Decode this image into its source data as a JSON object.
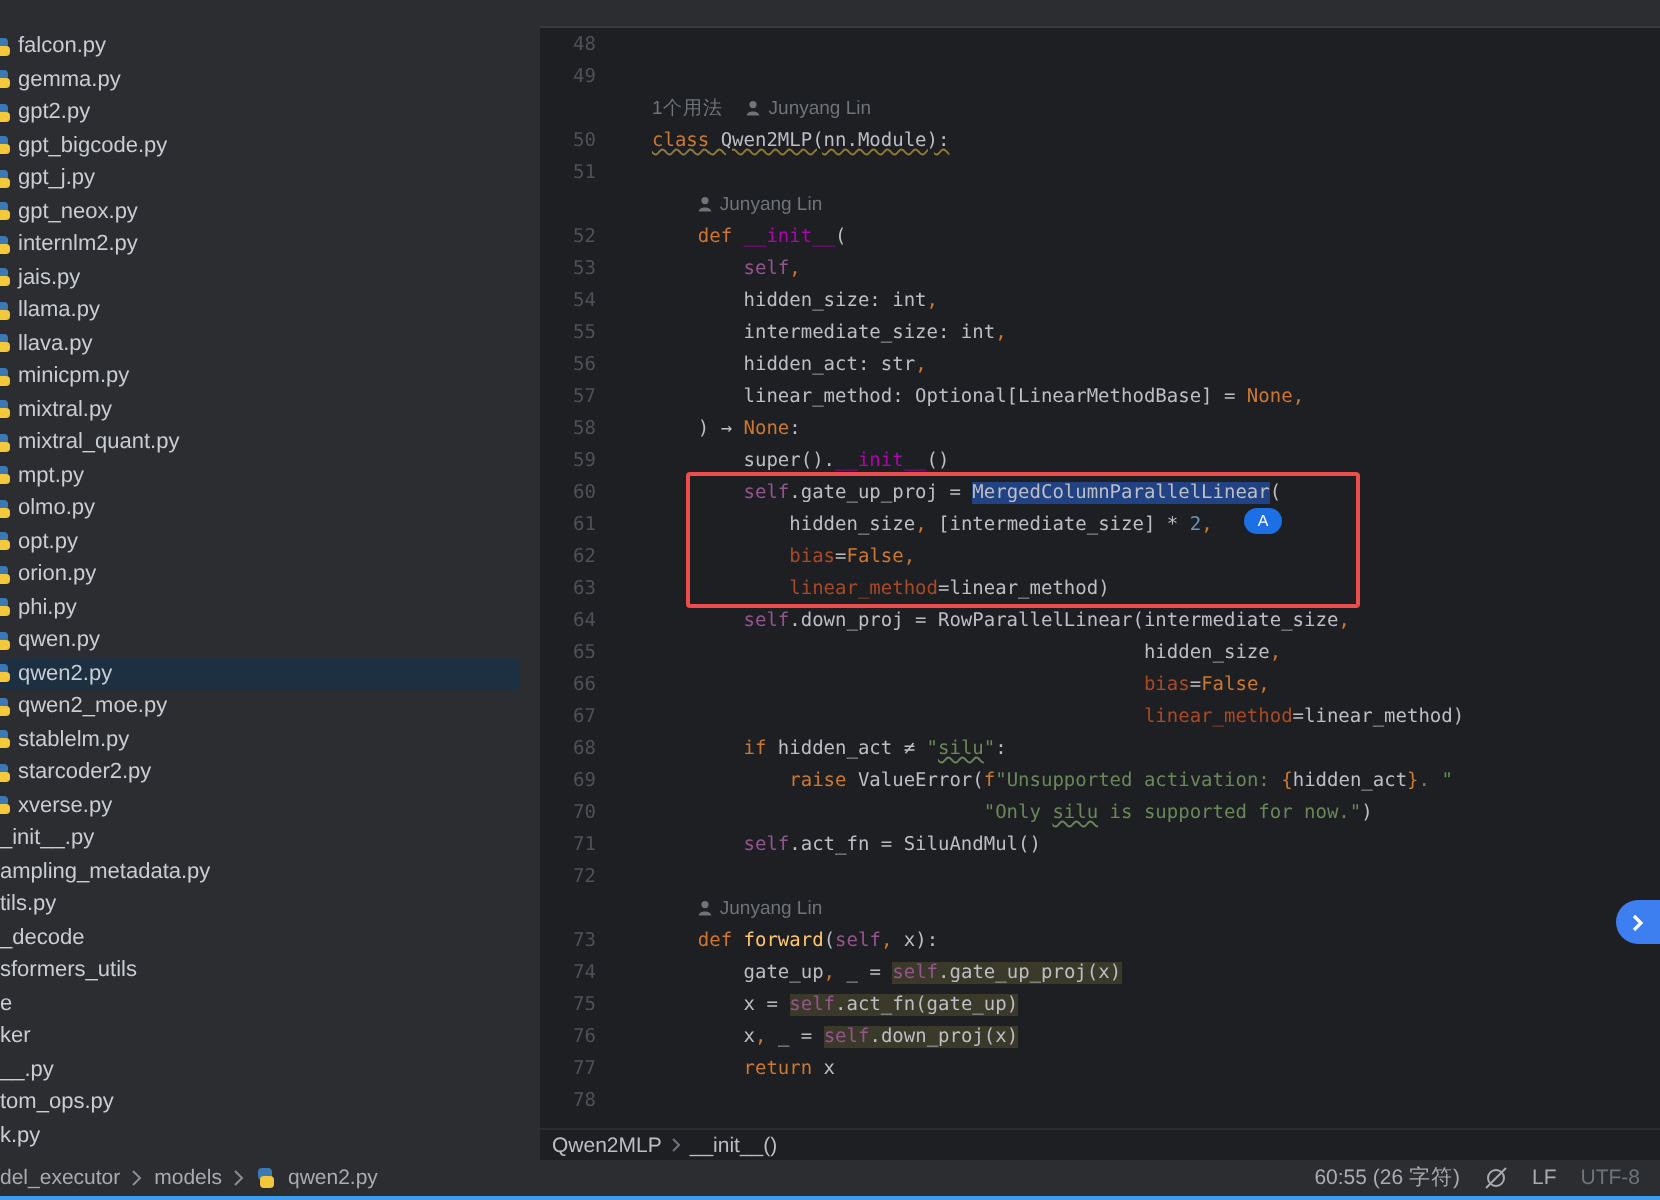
{
  "sidebar": {
    "items": [
      {
        "label": "falcon.py",
        "kind": "python",
        "selected": false
      },
      {
        "label": "gemma.py",
        "kind": "python",
        "selected": false
      },
      {
        "label": "gpt2.py",
        "kind": "python",
        "selected": false
      },
      {
        "label": "gpt_bigcode.py",
        "kind": "python",
        "selected": false
      },
      {
        "label": "gpt_j.py",
        "kind": "python",
        "selected": false
      },
      {
        "label": "gpt_neox.py",
        "kind": "python",
        "selected": false
      },
      {
        "label": "internlm2.py",
        "kind": "python",
        "selected": false
      },
      {
        "label": "jais.py",
        "kind": "python",
        "selected": false
      },
      {
        "label": "llama.py",
        "kind": "python",
        "selected": false
      },
      {
        "label": "llava.py",
        "kind": "python",
        "selected": false
      },
      {
        "label": "minicpm.py",
        "kind": "python",
        "selected": false
      },
      {
        "label": "mixtral.py",
        "kind": "python",
        "selected": false
      },
      {
        "label": "mixtral_quant.py",
        "kind": "python",
        "selected": false
      },
      {
        "label": "mpt.py",
        "kind": "python",
        "selected": false
      },
      {
        "label": "olmo.py",
        "kind": "python",
        "selected": false
      },
      {
        "label": "opt.py",
        "kind": "python",
        "selected": false
      },
      {
        "label": "orion.py",
        "kind": "python",
        "selected": false
      },
      {
        "label": "phi.py",
        "kind": "python",
        "selected": false
      },
      {
        "label": "qwen.py",
        "kind": "python",
        "selected": false
      },
      {
        "label": "qwen2.py",
        "kind": "python",
        "selected": true
      },
      {
        "label": "qwen2_moe.py",
        "kind": "python",
        "selected": false
      },
      {
        "label": "stablelm.py",
        "kind": "python",
        "selected": false
      },
      {
        "label": "starcoder2.py",
        "kind": "python",
        "selected": false
      },
      {
        "label": "xverse.py",
        "kind": "python",
        "selected": false
      },
      {
        "label": "_init__.py",
        "kind": "plain",
        "selected": false
      },
      {
        "label": "ampling_metadata.py",
        "kind": "plain",
        "selected": false
      },
      {
        "label": "tils.py",
        "kind": "plain",
        "selected": false
      },
      {
        "label": "_decode",
        "kind": "plain",
        "selected": false
      },
      {
        "label": "sformers_utils",
        "kind": "plain",
        "selected": false
      },
      {
        "label": "e",
        "kind": "plain",
        "selected": false
      },
      {
        "label": "ker",
        "kind": "plain",
        "selected": false
      },
      {
        "label": "__.py",
        "kind": "plain",
        "selected": false
      },
      {
        "label": "tom_ops.py",
        "kind": "plain",
        "selected": false
      },
      {
        "label": "k.py",
        "kind": "plain",
        "selected": false
      }
    ]
  },
  "editor": {
    "lines": [
      {
        "kind": "code",
        "number": "48"
      },
      {
        "kind": "code",
        "number": "49"
      },
      {
        "kind": "hint",
        "usages": "1个用法",
        "author": "Junyang Lin"
      },
      {
        "kind": "code",
        "number": "50",
        "tokens": [
          {
            "text": "class",
            "kind": "kw_warn"
          },
          {
            "text": " Qwen2MLP(nn.Module):",
            "kind": "warn"
          }
        ]
      },
      {
        "kind": "code",
        "number": "51"
      },
      {
        "kind": "hint",
        "author": "Junyang Lin"
      },
      {
        "kind": "code",
        "number": "52",
        "tokens": [
          {
            "text": "    def ",
            "kind": "kw"
          },
          {
            "text": "__init__",
            "kind": "dunder"
          },
          {
            "text": "(",
            "kind": "plain"
          }
        ]
      },
      {
        "kind": "code",
        "number": "53",
        "tokens": [
          {
            "text": "        self",
            "kind": "self"
          },
          {
            "text": ",",
            "kind": "comma"
          }
        ]
      },
      {
        "kind": "code",
        "number": "54",
        "tokens": [
          {
            "text": "        hidden_size: int",
            "kind": "plain"
          },
          {
            "text": ",",
            "kind": "comma"
          }
        ]
      },
      {
        "kind": "code",
        "number": "55",
        "tokens": [
          {
            "text": "        intermediate_size: int",
            "kind": "plain"
          },
          {
            "text": ",",
            "kind": "comma"
          }
        ]
      },
      {
        "kind": "code",
        "number": "56",
        "tokens": [
          {
            "text": "        hidden_act: str",
            "kind": "plain"
          },
          {
            "text": ",",
            "kind": "comma"
          }
        ]
      },
      {
        "kind": "code",
        "number": "57",
        "tokens": [
          {
            "text": "        linear_method: Optional[LinearMethodBase] = ",
            "kind": "plain"
          },
          {
            "text": "None",
            "kind": "kw"
          },
          {
            "text": ",",
            "kind": "comma"
          }
        ]
      },
      {
        "kind": "code",
        "number": "58",
        "tokens": [
          {
            "text": "    ) → ",
            "kind": "plain"
          },
          {
            "text": "None",
            "kind": "kw"
          },
          {
            "text": ":",
            "kind": "plain"
          }
        ]
      },
      {
        "kind": "code",
        "number": "59",
        "tokens": [
          {
            "text": "        super().",
            "kind": "plain"
          },
          {
            "text": "__init__",
            "kind": "dunder"
          },
          {
            "text": "()",
            "kind": "plain"
          }
        ]
      },
      {
        "kind": "code",
        "number": "60",
        "tokens": [
          {
            "text": "        self",
            "kind": "self"
          },
          {
            "text": ".gate_up_proj = ",
            "kind": "plain"
          },
          {
            "text": "MergedColumnParallelLinear",
            "kind": "sel"
          },
          {
            "text": "(",
            "kind": "plain"
          }
        ]
      },
      {
        "kind": "code",
        "number": "61",
        "tokens": [
          {
            "text": "            hidden_size",
            "kind": "plain"
          },
          {
            "text": ",",
            "kind": "comma"
          },
          {
            "text": " [intermediate_size] * ",
            "kind": "plain"
          },
          {
            "text": "2",
            "kind": "num"
          },
          {
            "text": ",",
            "kind": "comma"
          }
        ]
      },
      {
        "kind": "code",
        "number": "62",
        "tokens": [
          {
            "text": "            bias",
            "kind": "param"
          },
          {
            "text": "=",
            "kind": "plain"
          },
          {
            "text": "False",
            "kind": "kw"
          },
          {
            "text": ",",
            "kind": "comma"
          }
        ]
      },
      {
        "kind": "code",
        "number": "63",
        "tokens": [
          {
            "text": "            linear_method",
            "kind": "param"
          },
          {
            "text": "=linear_method)",
            "kind": "plain"
          }
        ]
      },
      {
        "kind": "code",
        "number": "64",
        "tokens": [
          {
            "text": "        self",
            "kind": "self"
          },
          {
            "text": ".down_proj = RowParallelLinear(intermediate_size",
            "kind": "plain"
          },
          {
            "text": ",",
            "kind": "comma"
          }
        ]
      },
      {
        "kind": "code",
        "number": "65",
        "tokens": [
          {
            "text": "                                           hidden_size",
            "kind": "plain"
          },
          {
            "text": ",",
            "kind": "comma"
          }
        ]
      },
      {
        "kind": "code",
        "number": "66",
        "tokens": [
          {
            "text": "                                           bias",
            "kind": "param"
          },
          {
            "text": "=",
            "kind": "plain"
          },
          {
            "text": "False",
            "kind": "kw"
          },
          {
            "text": ",",
            "kind": "comma"
          }
        ]
      },
      {
        "kind": "code",
        "number": "67",
        "tokens": [
          {
            "text": "                                           linear_method",
            "kind": "param"
          },
          {
            "text": "=linear_method)",
            "kind": "plain"
          }
        ]
      },
      {
        "kind": "code",
        "number": "68",
        "tokens": [
          {
            "text": "        if",
            "kind": "kw"
          },
          {
            "text": " hidden_act ≠ ",
            "kind": "plain"
          },
          {
            "text": "\"",
            "kind": "str"
          },
          {
            "text": "silu",
            "kind": "str_typo"
          },
          {
            "text": "\"",
            "kind": "str"
          },
          {
            "text": ":",
            "kind": "plain"
          }
        ]
      },
      {
        "kind": "code",
        "number": "69",
        "tokens": [
          {
            "text": "            raise",
            "kind": "kw"
          },
          {
            "text": " ValueError(",
            "kind": "plain"
          },
          {
            "text": "f",
            "kind": "kw"
          },
          {
            "text": "\"Unsupported activation: ",
            "kind": "str"
          },
          {
            "text": "{",
            "kind": "kw"
          },
          {
            "text": "hidden_act",
            "kind": "plain"
          },
          {
            "text": "}",
            "kind": "kw"
          },
          {
            "text": ". \"",
            "kind": "str"
          }
        ]
      },
      {
        "kind": "code",
        "number": "70",
        "tokens": [
          {
            "text": "                             \"Only ",
            "kind": "str"
          },
          {
            "text": "silu",
            "kind": "str_typo"
          },
          {
            "text": " is supported for now.\"",
            "kind": "str"
          },
          {
            "text": ")",
            "kind": "plain"
          }
        ]
      },
      {
        "kind": "code",
        "number": "71",
        "tokens": [
          {
            "text": "        self",
            "kind": "self"
          },
          {
            "text": ".act_fn = SiluAndMul()",
            "kind": "plain"
          }
        ]
      },
      {
        "kind": "code",
        "number": "72"
      },
      {
        "kind": "hint",
        "author": "Junyang Lin"
      },
      {
        "kind": "code",
        "number": "73",
        "tokens": [
          {
            "text": "    def ",
            "kind": "kw"
          },
          {
            "text": "forward",
            "kind": "fn"
          },
          {
            "text": "(",
            "kind": "plain"
          },
          {
            "text": "self",
            "kind": "self"
          },
          {
            "text": ",",
            "kind": "comma"
          },
          {
            "text": " x):",
            "kind": "plain"
          }
        ]
      },
      {
        "kind": "code",
        "number": "74",
        "tokens": [
          {
            "text": "        gate_up",
            "kind": "plain"
          },
          {
            "text": ",",
            "kind": "comma"
          },
          {
            "text": " _ = ",
            "kind": "plain"
          },
          {
            "text": "self",
            "kind": "self_usage"
          },
          {
            "text": ".gate_up_proj(x)",
            "kind": "usage"
          }
        ]
      },
      {
        "kind": "code",
        "number": "75",
        "tokens": [
          {
            "text": "        x = ",
            "kind": "plain"
          },
          {
            "text": "self",
            "kind": "self_usage"
          },
          {
            "text": ".act_fn(gate_up)",
            "kind": "usage"
          }
        ]
      },
      {
        "kind": "code",
        "number": "76",
        "tokens": [
          {
            "text": "        x",
            "kind": "plain"
          },
          {
            "text": ",",
            "kind": "comma"
          },
          {
            "text": " _ = ",
            "kind": "plain"
          },
          {
            "text": "self",
            "kind": "self_usage"
          },
          {
            "text": ".down_proj(x)",
            "kind": "usage"
          }
        ]
      },
      {
        "kind": "code",
        "number": "77",
        "tokens": [
          {
            "text": "        return",
            "kind": "kw"
          },
          {
            "text": " x",
            "kind": "plain"
          }
        ]
      },
      {
        "kind": "code",
        "number": "78"
      }
    ],
    "badge": "A",
    "breadcrumb": [
      "Qwen2MLP",
      "__init__()"
    ]
  },
  "status_bar": {
    "path": [
      {
        "label": "del_executor",
        "kind": "folder"
      },
      {
        "label": "models",
        "kind": "folder"
      },
      {
        "label": "qwen2.py",
        "kind": "python"
      }
    ],
    "position": "60:55 (26 字符)",
    "line_separator": "LF",
    "encoding": "UTF-8"
  }
}
